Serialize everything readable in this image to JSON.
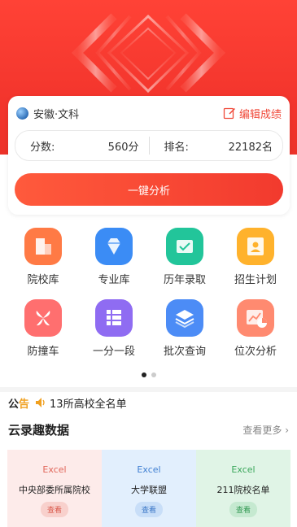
{
  "location": {
    "province_subject": "安徽·文科"
  },
  "edit_label": "编辑成绩",
  "score": {
    "label": "分数:",
    "value": "560分"
  },
  "rank": {
    "label": "排名:",
    "value": "22182名"
  },
  "analyze_label": "一键分析",
  "grid": [
    {
      "label": "院校库",
      "icon": "college-icon",
      "color": "#ff7a45"
    },
    {
      "label": "专业库",
      "icon": "diamond-icon",
      "color": "#3b8cf5"
    },
    {
      "label": "历年录取",
      "icon": "mail-icon",
      "color": "#22c59a"
    },
    {
      "label": "招生计划",
      "icon": "person-card-icon",
      "color": "#ffb22c"
    },
    {
      "label": "防撞车",
      "icon": "fan-icon",
      "color": "#ff6f6f"
    },
    {
      "label": "一分一段",
      "icon": "grid-table-icon",
      "color": "#8f6cf2"
    },
    {
      "label": "批次查询",
      "icon": "layers-icon",
      "color": "#4c8cf6"
    },
    {
      "label": "位次分析",
      "icon": "chart-icon",
      "color": "#ff8a70"
    }
  ],
  "pager": {
    "current": 1,
    "total": 2
  },
  "notice": {
    "badge_a": "公",
    "badge_b": "告",
    "text": "13所高校全名单"
  },
  "section": {
    "title": "云录趣数据",
    "more": "查看更多"
  },
  "data_cards": [
    {
      "tag": "Excel",
      "name": "中央部委所属院校",
      "view": "查看",
      "bg": "#fdebea",
      "tag_color": "#e0665a",
      "btn_bg": "#f8d0cc",
      "btn_color": "#d9584b"
    },
    {
      "tag": "Excel",
      "name": "大学联盟",
      "view": "查看",
      "bg": "#e2effd",
      "tag_color": "#3f7fd2",
      "btn_bg": "#c8def8",
      "btn_color": "#3a76c6"
    },
    {
      "tag": "Excel",
      "name": "211院校名单",
      "view": "查看",
      "bg": "#e0f4e6",
      "tag_color": "#3aa65a",
      "btn_bg": "#c5e9d0",
      "btn_color": "#2f9650"
    }
  ]
}
